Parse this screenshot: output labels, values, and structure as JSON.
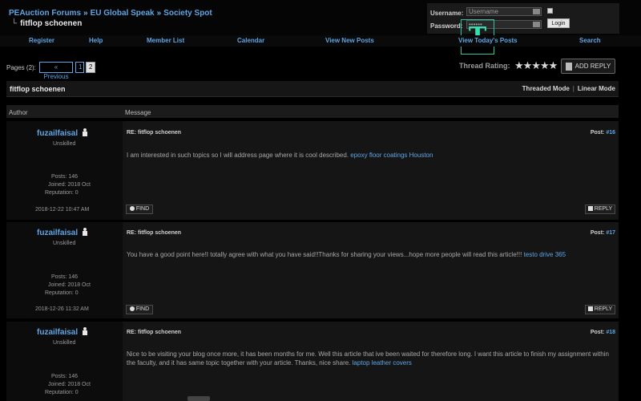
{
  "breadcrumb": {
    "items": [
      "PEAuction Forums",
      "EU Global Speak",
      "Society Spot"
    ],
    "separator": "»",
    "current": "fitflop schoenen"
  },
  "login": {
    "username_label": "Username:",
    "username_placeholder": "Username",
    "password_label": "Password:",
    "password_value": "••••••",
    "login_button": "Login"
  },
  "overlay_logo": "T",
  "nav": [
    "Register",
    "Help",
    "Member List",
    "Calendar",
    "View New Posts",
    "View Today's Posts",
    "Search"
  ],
  "pagination": {
    "label": "Pages (2):",
    "previous": "« Previous",
    "pages": [
      "1",
      "2"
    ],
    "current": "2"
  },
  "rating": {
    "label": "Thread Rating:",
    "stars": "★★★★★"
  },
  "add_reply": "ADD REPLY",
  "thread": {
    "title": "fitflop schoenen",
    "threaded_mode": "Threaded Mode",
    "linear_mode": "Linear Mode",
    "mode_separator": "|"
  },
  "columns": {
    "author": "Author",
    "message": "Message"
  },
  "posts": [
    {
      "author": "fuzailfaisal",
      "usertitle": "Unskilled",
      "posts": "Posts: 146",
      "joined": "Joined: 2018 Oct",
      "reputation": "Reputation: 0",
      "date": "2018-12-22 10:47 AM",
      "subject": "RE: fitflop schoenen",
      "post_label": "Post:",
      "post_num": "#16",
      "text": "I am interested in such topics so I will address page where it is cool described.",
      "link": "epoxy floor coatings Houston",
      "find": "FIND",
      "reply": "REPLY"
    },
    {
      "author": "fuzailfaisal",
      "usertitle": "Unskilled",
      "posts": "Posts: 146",
      "joined": "Joined: 2018 Oct",
      "reputation": "Reputation: 0",
      "date": "2018-12-26 11:32 AM",
      "subject": "RE: fitflop schoenen",
      "post_label": "Post:",
      "post_num": "#17",
      "text": "You have a good point here!I totally agree with what you have said!!Thanks for sharing your views...hope more people will read this article!!!",
      "link": "testo drive 365",
      "find": "FIND",
      "reply": "REPLY"
    },
    {
      "author": "fuzailfaisal",
      "usertitle": "Unskilled",
      "posts": "Posts: 146",
      "joined": "Joined: 2018 Oct",
      "reputation": "Reputation: 0",
      "subject": "RE: fitflop schoenen",
      "post_label": "Post:",
      "post_num": "#18",
      "text": "Nice to be visiting your blog once more, it has been months for me. Well this article that ive been waited for therefore long. I want this article to finish my assignment within the faculty, and it has same topic together with your article. Thanks, nice share.",
      "link": "laptop leather covers"
    }
  ]
}
